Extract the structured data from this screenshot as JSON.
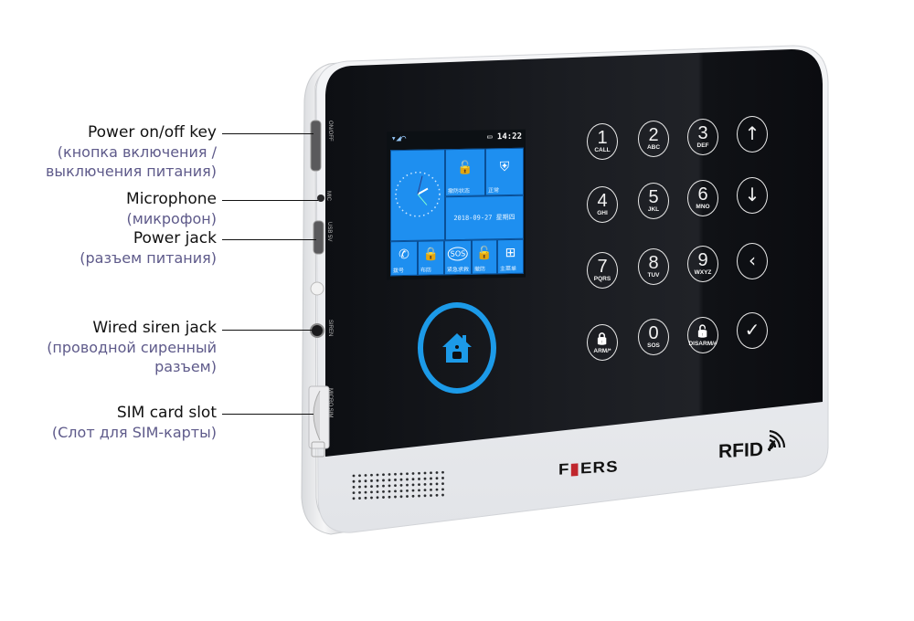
{
  "callouts": [
    {
      "en": "Power on/off key",
      "ru_lines": [
        "(кнопка включения /",
        "выключения питания)"
      ]
    },
    {
      "en": "Microphone",
      "ru_lines": [
        "(микрофон)"
      ]
    },
    {
      "en": "Power jack",
      "ru_lines": [
        "(разъем питания)"
      ]
    },
    {
      "en": "Wired siren jack",
      "ru_lines": [
        "(проводной сиренный",
        "разъем)"
      ]
    },
    {
      "en": "SIM card slot",
      "ru_lines": [
        "(Слот для SIM-карты)"
      ]
    }
  ],
  "side_labels": {
    "power": "ON/OFF",
    "mic": "MIC",
    "usb": "USB 5V",
    "siren": "SIREN",
    "sim": "MICRO SIM"
  },
  "screen": {
    "signal_icons": "signal-wifi",
    "time": "14:22",
    "date": "2018-09-27 星期四",
    "tiles": [
      {
        "id": "clock",
        "label": ""
      },
      {
        "id": "disarm-status",
        "label": "撤防状态",
        "icon": "unlock-icon"
      },
      {
        "id": "normal",
        "label": "正常",
        "icon": "shield-icon"
      },
      {
        "id": "dial",
        "label": "拨号",
        "icon": "phone-icon"
      },
      {
        "id": "arm",
        "label": "布防",
        "icon": "lock-icon"
      },
      {
        "id": "sos",
        "label": "紧急求救",
        "icon": "sos-icon"
      },
      {
        "id": "disarm",
        "label": "撤防",
        "icon": "unlock-icon"
      },
      {
        "id": "main-menu",
        "label": "主菜单",
        "icon": "grid-icon"
      }
    ]
  },
  "keypad": [
    {
      "num": "1",
      "sub": "CALL"
    },
    {
      "num": "2",
      "sub": "ABC"
    },
    {
      "num": "3",
      "sub": "DEF"
    },
    {
      "glyph": "↑",
      "name": "up"
    },
    {
      "num": "4",
      "sub": "GHI"
    },
    {
      "num": "5",
      "sub": "JKL"
    },
    {
      "num": "6",
      "sub": "MNO"
    },
    {
      "glyph": "↓",
      "name": "down"
    },
    {
      "num": "7",
      "sub": "PQRS"
    },
    {
      "num": "8",
      "sub": "TUV"
    },
    {
      "num": "9",
      "sub": "WXYZ"
    },
    {
      "glyph": "‹",
      "name": "back"
    },
    {
      "num": "🔒",
      "sub": "ARM/*",
      "name": "arm"
    },
    {
      "num": "0",
      "sub": "SOS"
    },
    {
      "num": "🔓",
      "sub": "DISARM/#",
      "name": "disarm"
    },
    {
      "glyph": "✓",
      "name": "confirm"
    }
  ],
  "brand": {
    "pre": "F",
    "accent": "▮",
    "post": "ERS",
    "full": "FUERS"
  },
  "rfid_label": "RFID",
  "colors": {
    "accent_blue": "#1c9ae8",
    "panel_black": "#0f1115",
    "body_white": "#eef0f3",
    "brand_red": "#c0262d",
    "ru_text": "#5e5a8a"
  }
}
